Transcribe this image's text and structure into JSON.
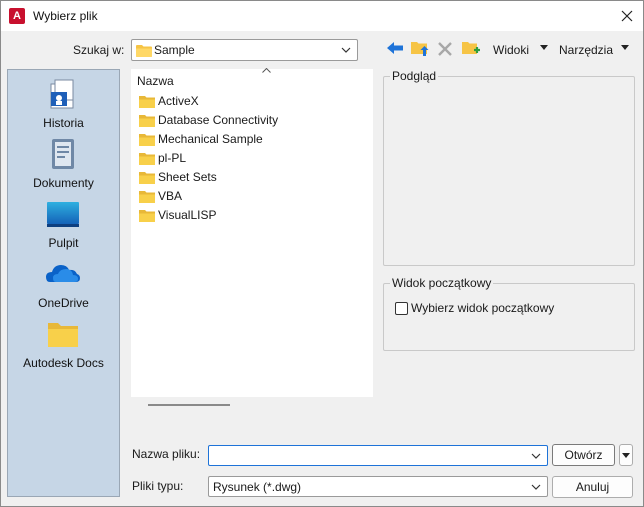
{
  "window": {
    "title": "Wybierz plik",
    "app_icon_letter": "A"
  },
  "lookin": {
    "label": "Szukaj w:",
    "value": "Sample"
  },
  "toolbar": {
    "views_label": "Widoki",
    "tools_label": "Narzędzia"
  },
  "sidebar": {
    "items": [
      {
        "label": "Historia",
        "icon": "history-icon"
      },
      {
        "label": "Dokumenty",
        "icon": "documents-icon"
      },
      {
        "label": "Pulpit",
        "icon": "desktop-icon"
      },
      {
        "label": "OneDrive",
        "icon": "onedrive-icon"
      },
      {
        "label": "Autodesk Docs",
        "icon": "autodesk-docs-folder-icon"
      }
    ]
  },
  "filelist": {
    "column_name": "Nazwa",
    "items": [
      "ActiveX",
      "Database Connectivity",
      "Mechanical Sample",
      "pl-PL",
      "Sheet Sets",
      "VBA",
      "VisualLISP"
    ]
  },
  "preview": {
    "label": "Podgląd"
  },
  "initial_view": {
    "group_label": "Widok początkowy",
    "checkbox_label": "Wybierz widok początkowy",
    "checked": false
  },
  "filename": {
    "label": "Nazwa pliku:",
    "value": ""
  },
  "filetype": {
    "label": "Pliki typu:",
    "value": "Rysunek (*.dwg)"
  },
  "buttons": {
    "open": "Otwórz",
    "cancel": "Anuluj"
  },
  "colors": {
    "folder": "#f6c445",
    "accent_blue": "#1e73d8",
    "sidebar_bg": "#c6d6e6",
    "app_red": "#c8102e"
  }
}
